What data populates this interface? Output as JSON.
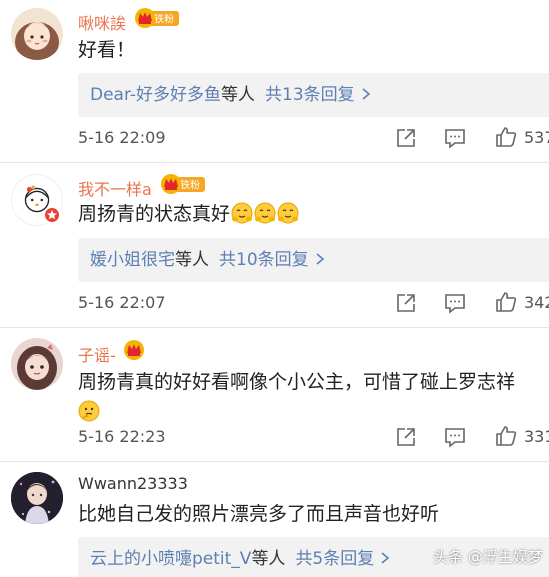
{
  "colors": {
    "username": "#eb7350",
    "link": "#5d7fb3",
    "reply_bg": "#f2f2f2",
    "badge_red": "#e8412f"
  },
  "comments": [
    {
      "username": "啾咪誒",
      "fan_badge": "铁粉",
      "text": "好看！",
      "reply_preview": {
        "names": "Dear-好多好多鱼",
        "mid": "等人",
        "total": "共13条回复"
      },
      "time": "5-16 22:09",
      "likes": "537"
    },
    {
      "username": "我不一样a",
      "fan_badge": "铁粉",
      "text": "周扬青的状态真好",
      "emoji": [
        "hug-emoji",
        "hug-emoji",
        "hug-emoji"
      ],
      "reply_preview": {
        "names": "媛小姐很宅",
        "mid": "等人",
        "total": "共10条回复"
      },
      "time": "5-16 22:07",
      "likes": "342"
    },
    {
      "username": "子谣-",
      "text": "周扬青真的好好看啊像个小公主，可惜了碰上罗志祥",
      "emoji": [
        "thinking-emoji"
      ],
      "time": "5-16 22:23",
      "likes": "331"
    },
    {
      "username": "Wwann23333",
      "text": "比她自己发的照片漂亮多了而且声音也好听",
      "reply_preview": {
        "names": "云上的小喷嚏petit_V",
        "mid": "等人",
        "total": "共5条回复"
      }
    }
  ],
  "watermark": "头条 @浮生娱梦"
}
